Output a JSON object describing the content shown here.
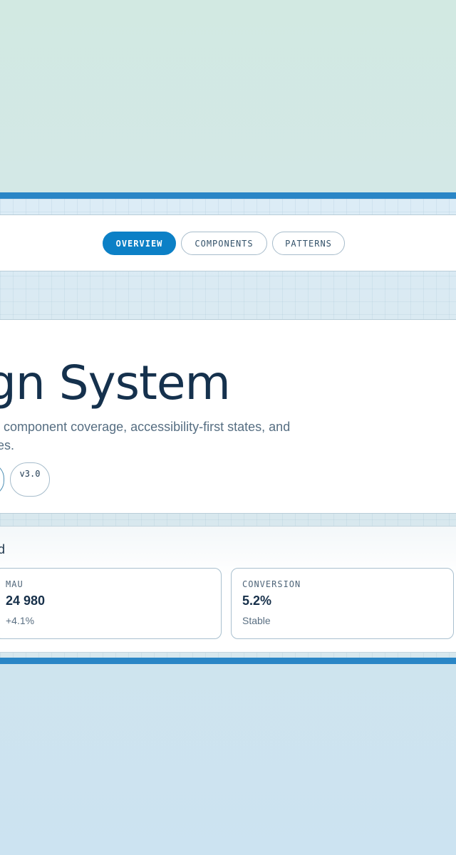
{
  "nav": {
    "tabs": [
      {
        "label": "OVERVIEW",
        "active": true
      },
      {
        "label": "COMPONENTS",
        "active": false
      },
      {
        "label": "PATTERNS",
        "active": false
      }
    ]
  },
  "hero": {
    "title": "gn System",
    "description_line1": "ch component coverage, accessibility-first states, and",
    "description_line2": "ates.",
    "badges": [
      "",
      "v3.0"
    ]
  },
  "dashboard": {
    "title": "ord",
    "metrics": [
      {
        "label": "MAU",
        "value": "24 980",
        "sub": "+4.1%"
      },
      {
        "label": "CONVERSION",
        "value": "5.2%",
        "sub": "Stable"
      }
    ]
  },
  "colors": {
    "accent": "#0c80c6",
    "stripe": "#2a86c6",
    "text_dark": "#15314d",
    "text_muted": "#566e82",
    "border": "#a7bccb"
  }
}
